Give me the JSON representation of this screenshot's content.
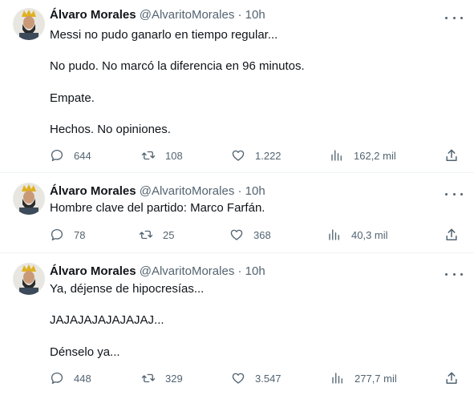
{
  "colors": {
    "text": "#0f1419",
    "muted": "#536471",
    "divider": "#eff3f4",
    "background": "#ffffff"
  },
  "icons": [
    "avatar-illustration",
    "more-icon",
    "reply-icon",
    "retweet-icon",
    "like-icon",
    "views-icon",
    "share-icon"
  ],
  "tweets": [
    {
      "author_name": "Álvaro Morales",
      "handle": "@AlvaritoMorales",
      "separator": "·",
      "time": "10h",
      "lines": [
        "Messi no pudo ganarlo en tiempo regular...",
        "No pudo. No marcó la diferencia en 96 minutos.",
        "Empate.",
        "Hechos. No opiniones."
      ],
      "replies": "644",
      "retweets": "108",
      "likes": "1.222",
      "views": "162,2 mil"
    },
    {
      "author_name": "Álvaro Morales",
      "handle": "@AlvaritoMorales",
      "separator": "·",
      "time": "10h",
      "lines": [
        "Hombre clave del partido: Marco Farfán."
      ],
      "replies": "78",
      "retweets": "25",
      "likes": "368",
      "views": "40,3 mil"
    },
    {
      "author_name": "Álvaro Morales",
      "handle": "@AlvaritoMorales",
      "separator": "·",
      "time": "10h",
      "lines": [
        "Ya, déjense de hipocresías...",
        "JAJAJAJAJAJAJAJ...",
        "Dénselo ya..."
      ],
      "replies": "448",
      "retweets": "329",
      "likes": "3.547",
      "views": "277,7 mil"
    }
  ]
}
